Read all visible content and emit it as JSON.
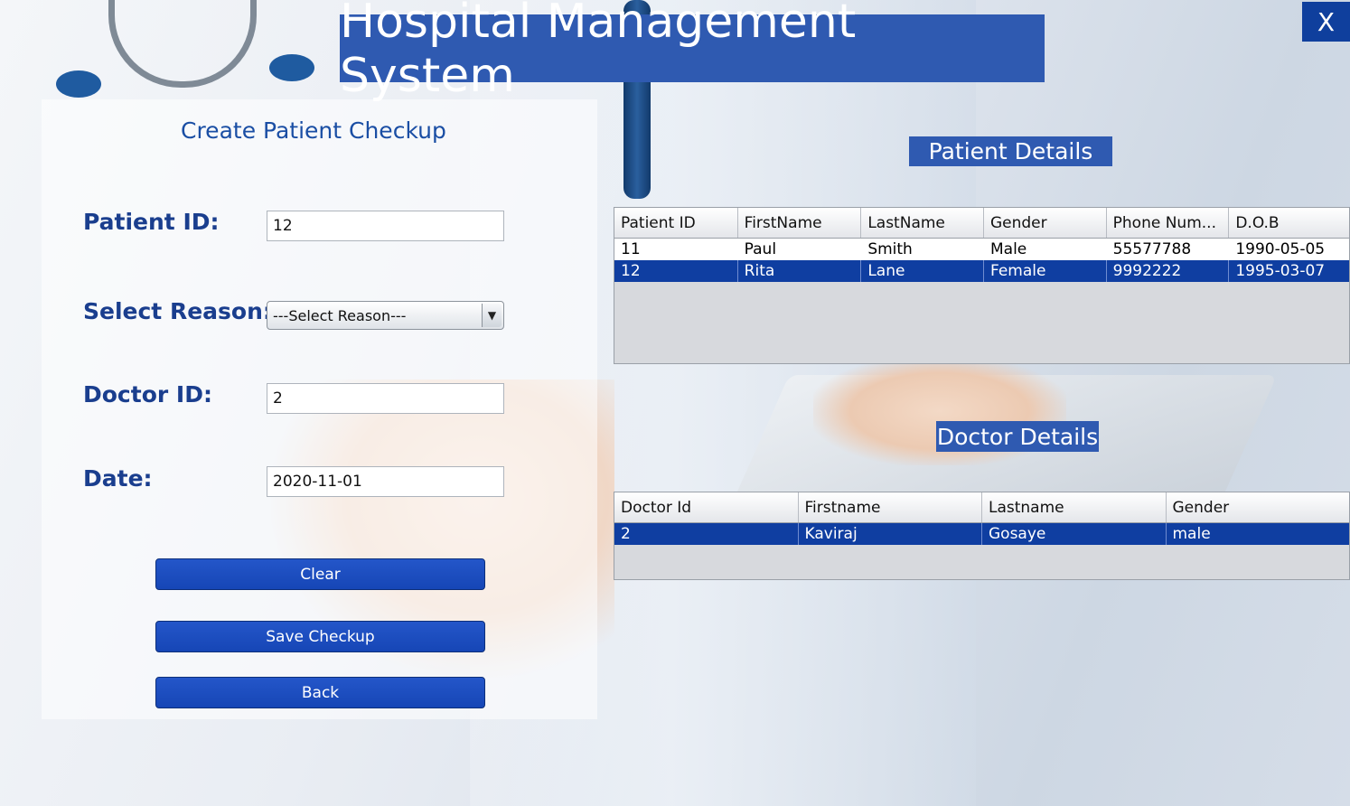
{
  "app": {
    "title": "Hospital Management System",
    "close_label": "X"
  },
  "form": {
    "heading": "Create Patient Checkup",
    "patient_id_label": "Patient ID:",
    "patient_id_value": "12",
    "reason_label": "Select Reason:",
    "reason_selected": "---Select Reason---",
    "doctor_id_label": "Doctor ID:",
    "doctor_id_value": "2",
    "date_label": "Date:",
    "date_value": "2020-11-01",
    "buttons": {
      "clear": "Clear",
      "save": "Save Checkup",
      "back": "Back"
    }
  },
  "patient_table": {
    "title": "Patient Details",
    "columns": [
      "Patient ID",
      "FirstName",
      "LastName",
      "Gender",
      "Phone Num...",
      "D.O.B"
    ],
    "rows": [
      [
        "11",
        "Paul",
        "Smith",
        "Male",
        "55577788",
        "1990-05-05"
      ],
      [
        "12",
        "Rita",
        "Lane",
        "Female",
        "9992222",
        "1995-03-07"
      ]
    ],
    "selected_row": 1
  },
  "doctor_table": {
    "title": "Doctor Details",
    "columns": [
      "Doctor Id",
      "Firstname",
      "Lastname",
      "Gender"
    ],
    "rows": [
      [
        "2",
        "Kaviraj",
        "Gosaye",
        "male"
      ]
    ],
    "selected_row": 0
  },
  "colors": {
    "primary": "#2f5ab1",
    "button": "#1f4fc0",
    "selection": "#0f3ea1",
    "label": "#1a3e8e"
  }
}
